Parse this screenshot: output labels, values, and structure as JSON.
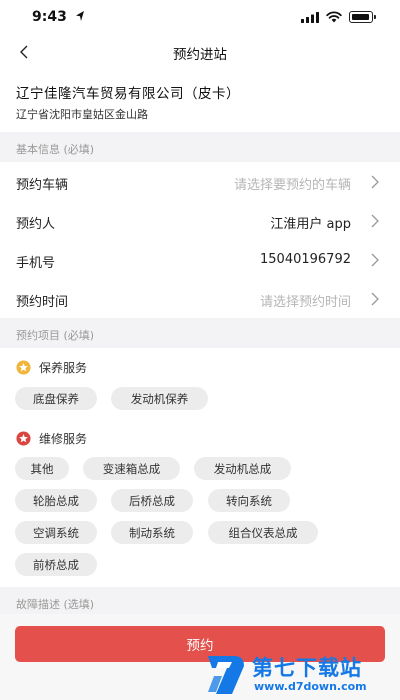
{
  "status_bar": {
    "time": "9:43"
  },
  "nav": {
    "title": "预约进站"
  },
  "company": {
    "name": "辽宁佳隆汽车贸易有限公司（皮卡）",
    "address": "辽宁省沈阳市皇姑区金山路"
  },
  "basic_info": {
    "header": "基本信息 (必填)",
    "rows": [
      {
        "label": "预约车辆",
        "value": "请选择要预约的车辆",
        "placeholder": true
      },
      {
        "label": "预约人",
        "value": "江淮用户 app",
        "placeholder": false
      },
      {
        "label": "手机号",
        "value": "15040196792",
        "placeholder": false
      },
      {
        "label": "预约时间",
        "value": "请选择预约时间",
        "placeholder": true
      }
    ]
  },
  "items": {
    "header": "预约项目 (必填)",
    "maintenance": {
      "title": "保养服务",
      "icon": "gold-star-icon",
      "chips": [
        "底盘保养",
        "发动机保养"
      ]
    },
    "repair": {
      "title": "维修服务",
      "icon": "red-star-icon",
      "chips": [
        "其他",
        "变速箱总成",
        "发动机总成",
        "轮胎总成",
        "后桥总成",
        "转向系统",
        "空调系统",
        "制动系统",
        "组合仪表总成",
        "前桥总成"
      ]
    }
  },
  "fault": {
    "header": "故障描述 (选填)"
  },
  "submit": {
    "label": "预约",
    "color": "#e4514c"
  },
  "watermark": {
    "title": "第七下载站",
    "url": "www.d7down.com",
    "color": "#1479e6"
  }
}
